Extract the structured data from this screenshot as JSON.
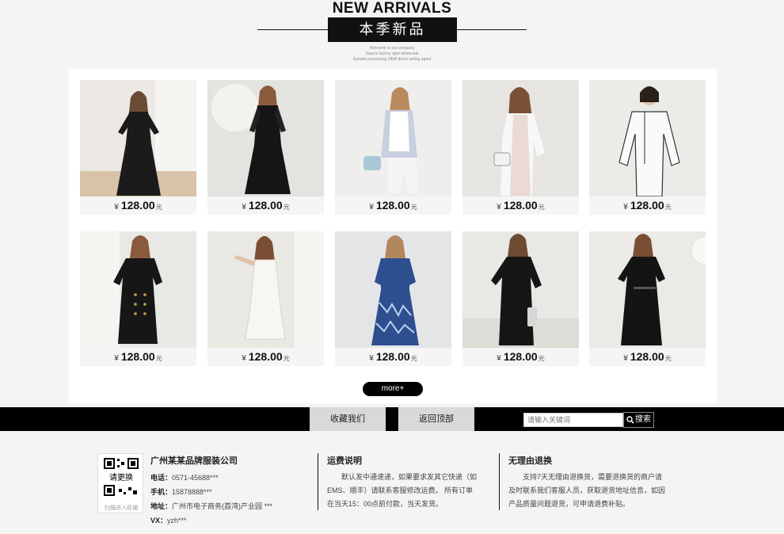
{
  "header": {
    "title_en": "NEW ARRIVALS",
    "title_cn": "本季新品",
    "subtitle_lines": [
      "Welcome to our company",
      "Source factory dpot wholesale",
      "Sample processing OEM direct selling agent"
    ]
  },
  "products": [
    {
      "currency": "¥",
      "price": "128.00",
      "unit": "元"
    },
    {
      "currency": "¥",
      "price": "128.00",
      "unit": "元"
    },
    {
      "currency": "¥",
      "price": "128.00",
      "unit": "元"
    },
    {
      "currency": "¥",
      "price": "128.00",
      "unit": "元"
    },
    {
      "currency": "¥",
      "price": "128.00",
      "unit": "元"
    },
    {
      "currency": "¥",
      "price": "128.00",
      "unit": "元"
    },
    {
      "currency": "¥",
      "price": "128.00",
      "unit": "元"
    },
    {
      "currency": "¥",
      "price": "128.00",
      "unit": "元"
    },
    {
      "currency": "¥",
      "price": "128.00",
      "unit": "元"
    },
    {
      "currency": "¥",
      "price": "128.00",
      "unit": "元"
    }
  ],
  "more_label": "more+",
  "bar": {
    "favorite_label": "收藏我们",
    "top_label": "返回顶部",
    "search_placeholder": "请输入关键词",
    "search_label": "搜索"
  },
  "footer": {
    "qr_text": "请更换",
    "qr_caption": "扫描进入旺铺",
    "company": "广州某某品牌服装公司",
    "phone_label": "电话：",
    "phone": "0571-45688***",
    "mobile_label": "手机：",
    "mobile": "15878888***",
    "address_label": "地址：",
    "address": "广州市电子商务(荔湾)产业园 ***",
    "vx_label": "VX：",
    "vx": "yzh***",
    "shipping_title": "运费说明",
    "shipping_text": "默认发中通速递，如果要求发其它快递（如EMS、顺丰）请联系客服修改运费。 所有订单在当天15：00点前付款，当天发货。",
    "return_title": "无理由退换",
    "return_text": "支持7天无理由退换货，需要退换货的商户请及时联系我们客服人员，获取退货地址信息，如因产品质量问题退货，可申请退费补贴。"
  },
  "colors": {
    "black": "#000000",
    "bar_button": "#d9d9d9",
    "panel": "#ffffff",
    "page_bg": "#f4f4f4"
  }
}
